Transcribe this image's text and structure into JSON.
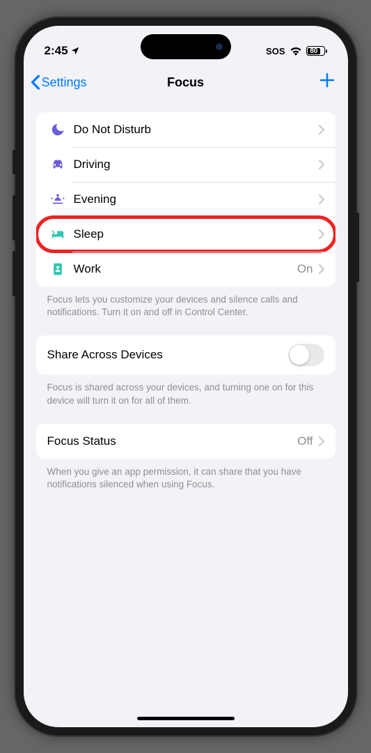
{
  "statusBar": {
    "time": "2:45",
    "sos": "SOS",
    "battery": "80"
  },
  "nav": {
    "back": "Settings",
    "title": "Focus"
  },
  "focusModes": [
    {
      "label": "Do Not Disturb",
      "icon": "moon",
      "color": "#6b5edb"
    },
    {
      "label": "Driving",
      "icon": "car",
      "color": "#6b5edb"
    },
    {
      "label": "Evening",
      "icon": "sunset",
      "color": "#6b5edb"
    },
    {
      "label": "Sleep",
      "icon": "bed",
      "color": "#30c6b0",
      "highlighted": true
    },
    {
      "label": "Work",
      "icon": "badge",
      "color": "#30c6b0",
      "value": "On"
    }
  ],
  "focusFooter": "Focus lets you customize your devices and silence calls and notifications. Turn it on and off in Control Center.",
  "shareRow": {
    "label": "Share Across Devices"
  },
  "shareFooter": "Focus is shared across your devices, and turning one on for this device will turn it on for all of them.",
  "statusRow": {
    "label": "Focus Status",
    "value": "Off"
  },
  "statusFooter": "When you give an app permission, it can share that you have notifications silenced when using Focus."
}
